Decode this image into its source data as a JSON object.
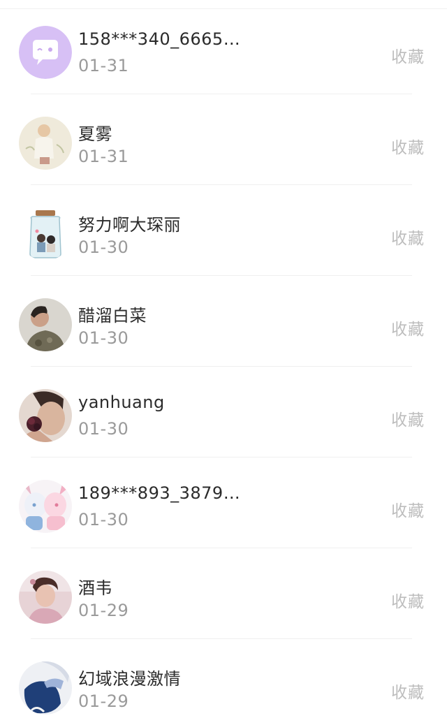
{
  "items": [
    {
      "name": "158***340_6665…",
      "date": "01-31",
      "action": "收藏",
      "avatar": "chat-bubble-avatar-icon"
    },
    {
      "name": "夏雾",
      "date": "01-31",
      "action": "收藏",
      "avatar": "illustration-avatar"
    },
    {
      "name": "努力啊大琛丽",
      "date": "01-30",
      "action": "收藏",
      "avatar": "jar-couple-avatar"
    },
    {
      "name": "醋溜白菜",
      "date": "01-30",
      "action": "收藏",
      "avatar": "man-photo-avatar"
    },
    {
      "name": "yanhuang",
      "date": "01-30",
      "action": "收藏",
      "avatar": "rose-man-avatar"
    },
    {
      "name": "189***893_3879…",
      "date": "01-30",
      "action": "收藏",
      "avatar": "anime-girls-avatar"
    },
    {
      "name": "酒韦",
      "date": "01-29",
      "action": "收藏",
      "avatar": "woman-photo-avatar"
    },
    {
      "name": "幻域浪漫激情",
      "date": "01-29",
      "action": "收藏",
      "avatar": "blue-dress-avatar"
    }
  ]
}
